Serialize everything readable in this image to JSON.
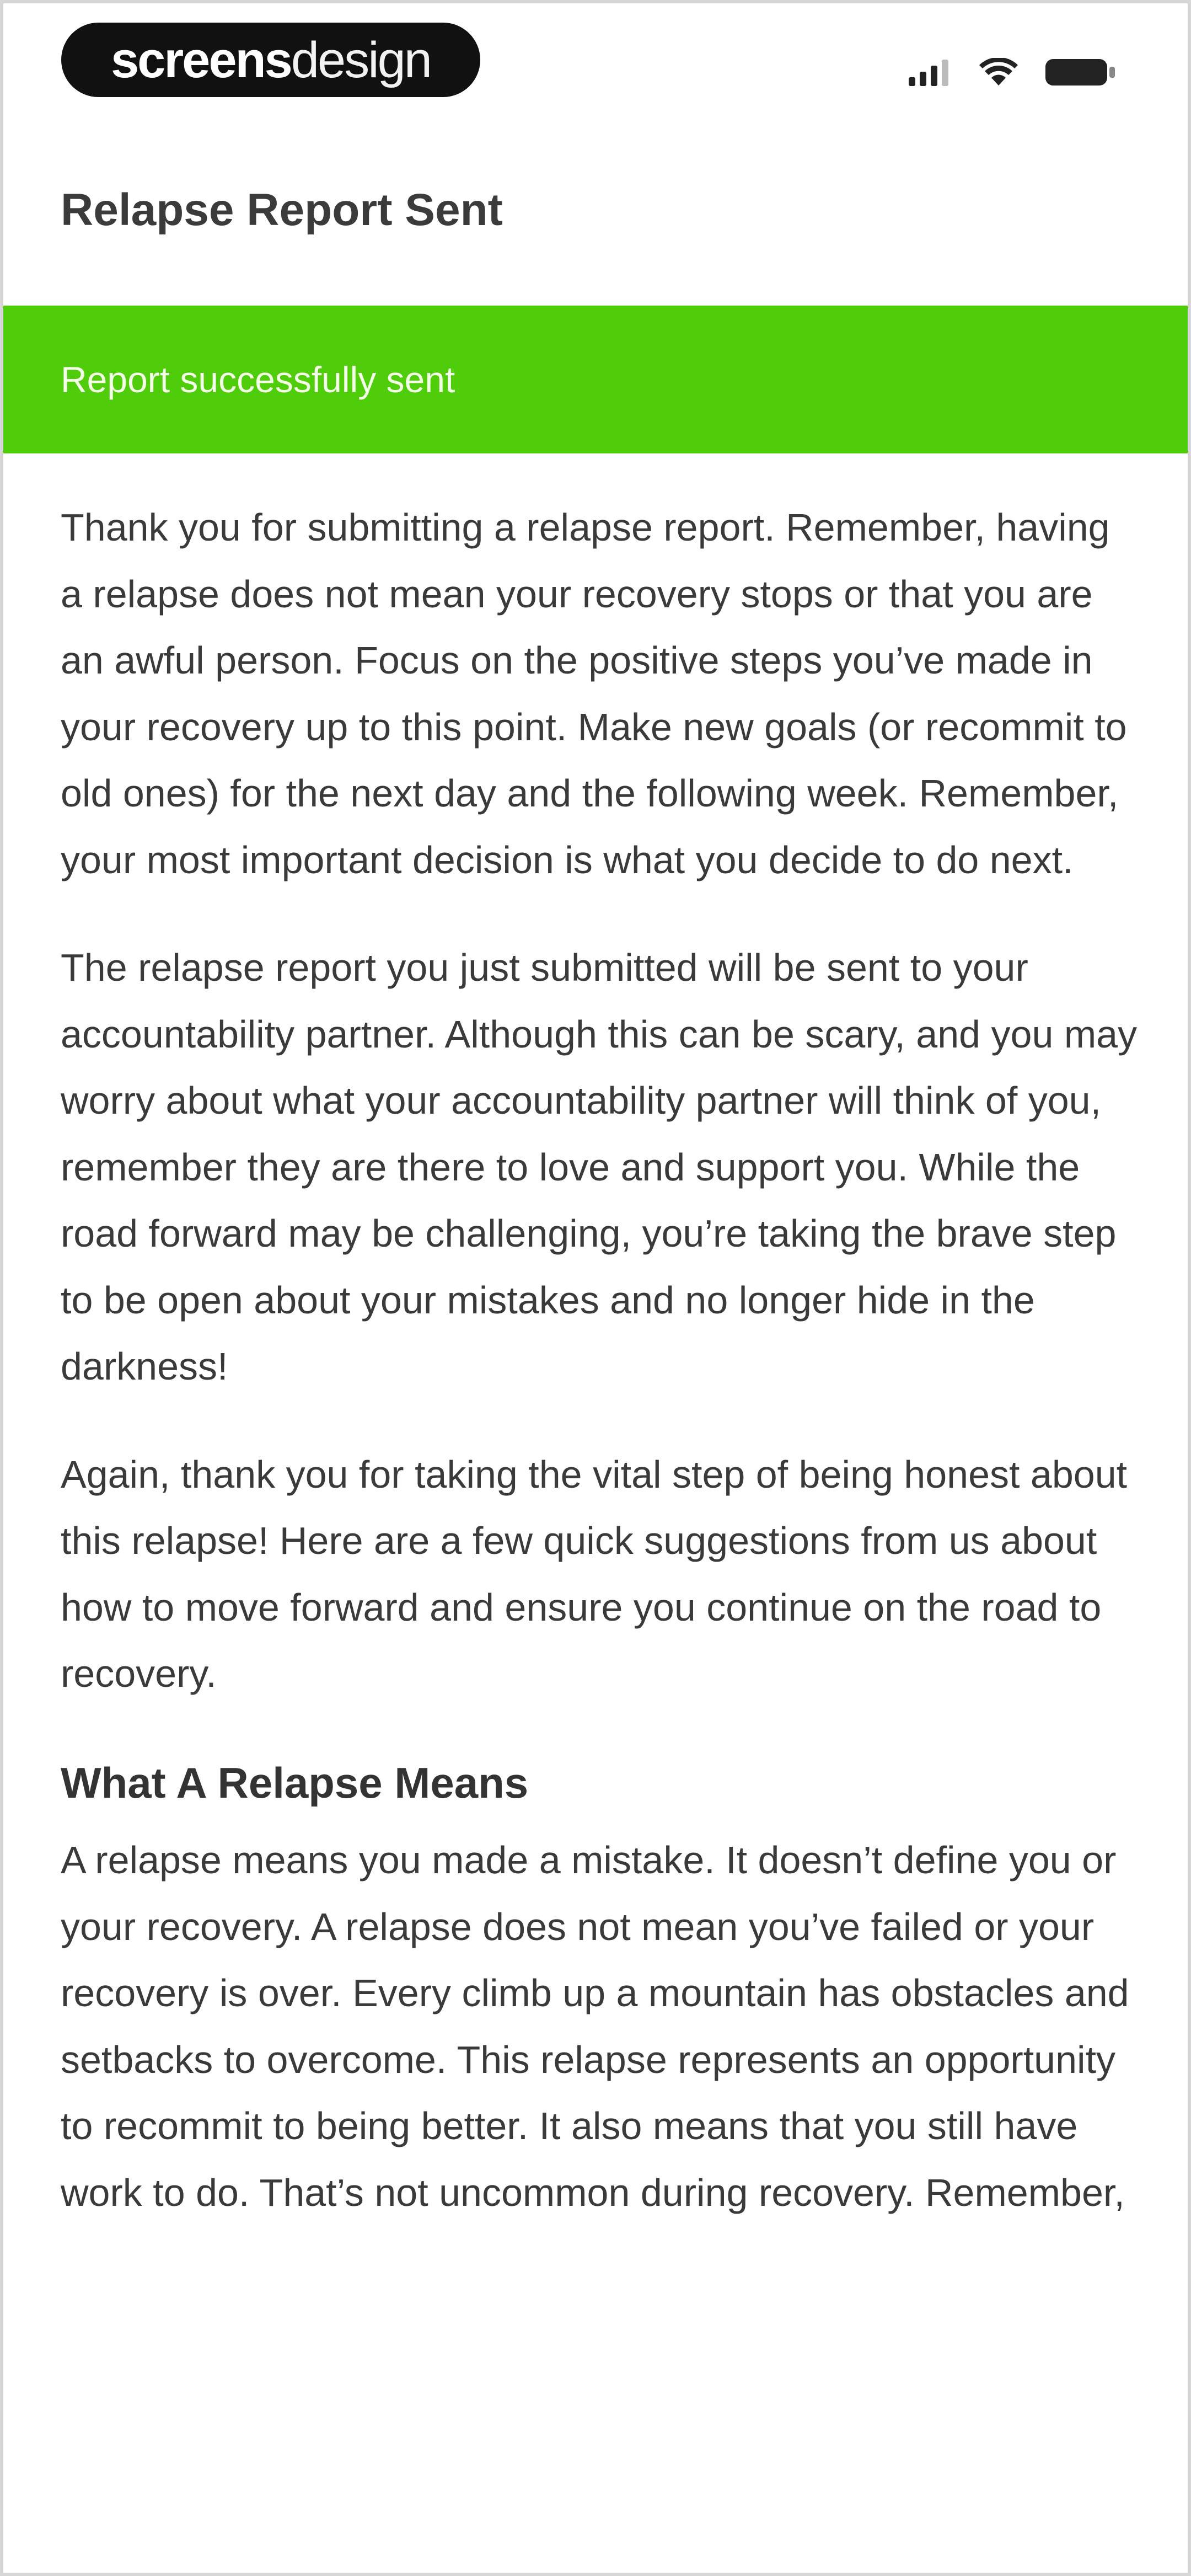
{
  "status_bar": {
    "brand_bold": "screens",
    "brand_light": "design",
    "icons": [
      "signal-icon",
      "wifi-icon",
      "battery-icon"
    ]
  },
  "header": {
    "title": "Relapse Report Sent"
  },
  "banner": {
    "message": "Report successfully sent",
    "color": "#4fcc0a"
  },
  "content": {
    "paragraphs": [
      "Thank you for submitting a relapse report. Remember, having a relapse does not mean your recovery stops or that you are an awful person. Focus on the positive steps you’ve made in your recovery up to this point. Make new goals (or recommit to old ones) for the next day and the following week. Remember, your most important decision is what you decide to do next.",
      "The relapse report you just submitted will be sent to your accountability partner. Although this can be scary, and you may worry about what your accountability partner will think of you, remember they are there to love and support you. While the road forward may be challenging, you’re taking the brave step to be open about your mistakes and no longer hide in the darkness!",
      "Again, thank you for taking the vital step of being honest about this relapse! Here are a few quick suggestions from us about how to move forward and ensure you continue on the road to recovery."
    ],
    "section": {
      "heading": "What A Relapse Means",
      "body": "A relapse means you made a mistake. It doesn’t define you or your recovery. A relapse does not mean you’ve failed or your recovery is over. Every climb up a mountain has obstacles and setbacks to overcome. This relapse represents an opportunity to recommit to being better. It also means that you still have work to do. That’s not uncommon during recovery. Remember,"
    }
  }
}
